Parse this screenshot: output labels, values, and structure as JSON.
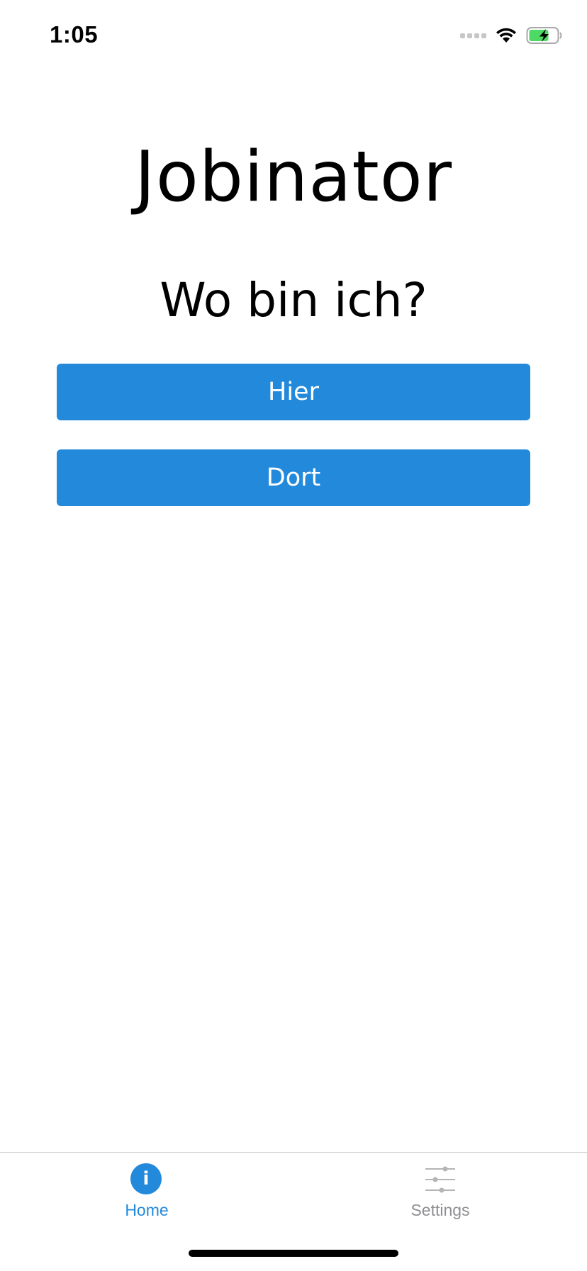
{
  "status_bar": {
    "time": "1:05",
    "icons": [
      "cellular-signal-icon",
      "wifi-icon",
      "battery-charging-icon"
    ],
    "battery_color": "#4cd964"
  },
  "main": {
    "app_title": "Jobinator",
    "question": "Wo bin ich?",
    "buttons": [
      {
        "label": "Hier"
      },
      {
        "label": "Dort"
      }
    ],
    "button_color": "#2389db"
  },
  "tab_bar": {
    "tabs": [
      {
        "label": "Home",
        "icon": "info-icon",
        "active": true
      },
      {
        "label": "Settings",
        "icon": "sliders-icon",
        "active": false
      }
    ],
    "active_color": "#2389db",
    "inactive_color": "#8e8e93"
  }
}
